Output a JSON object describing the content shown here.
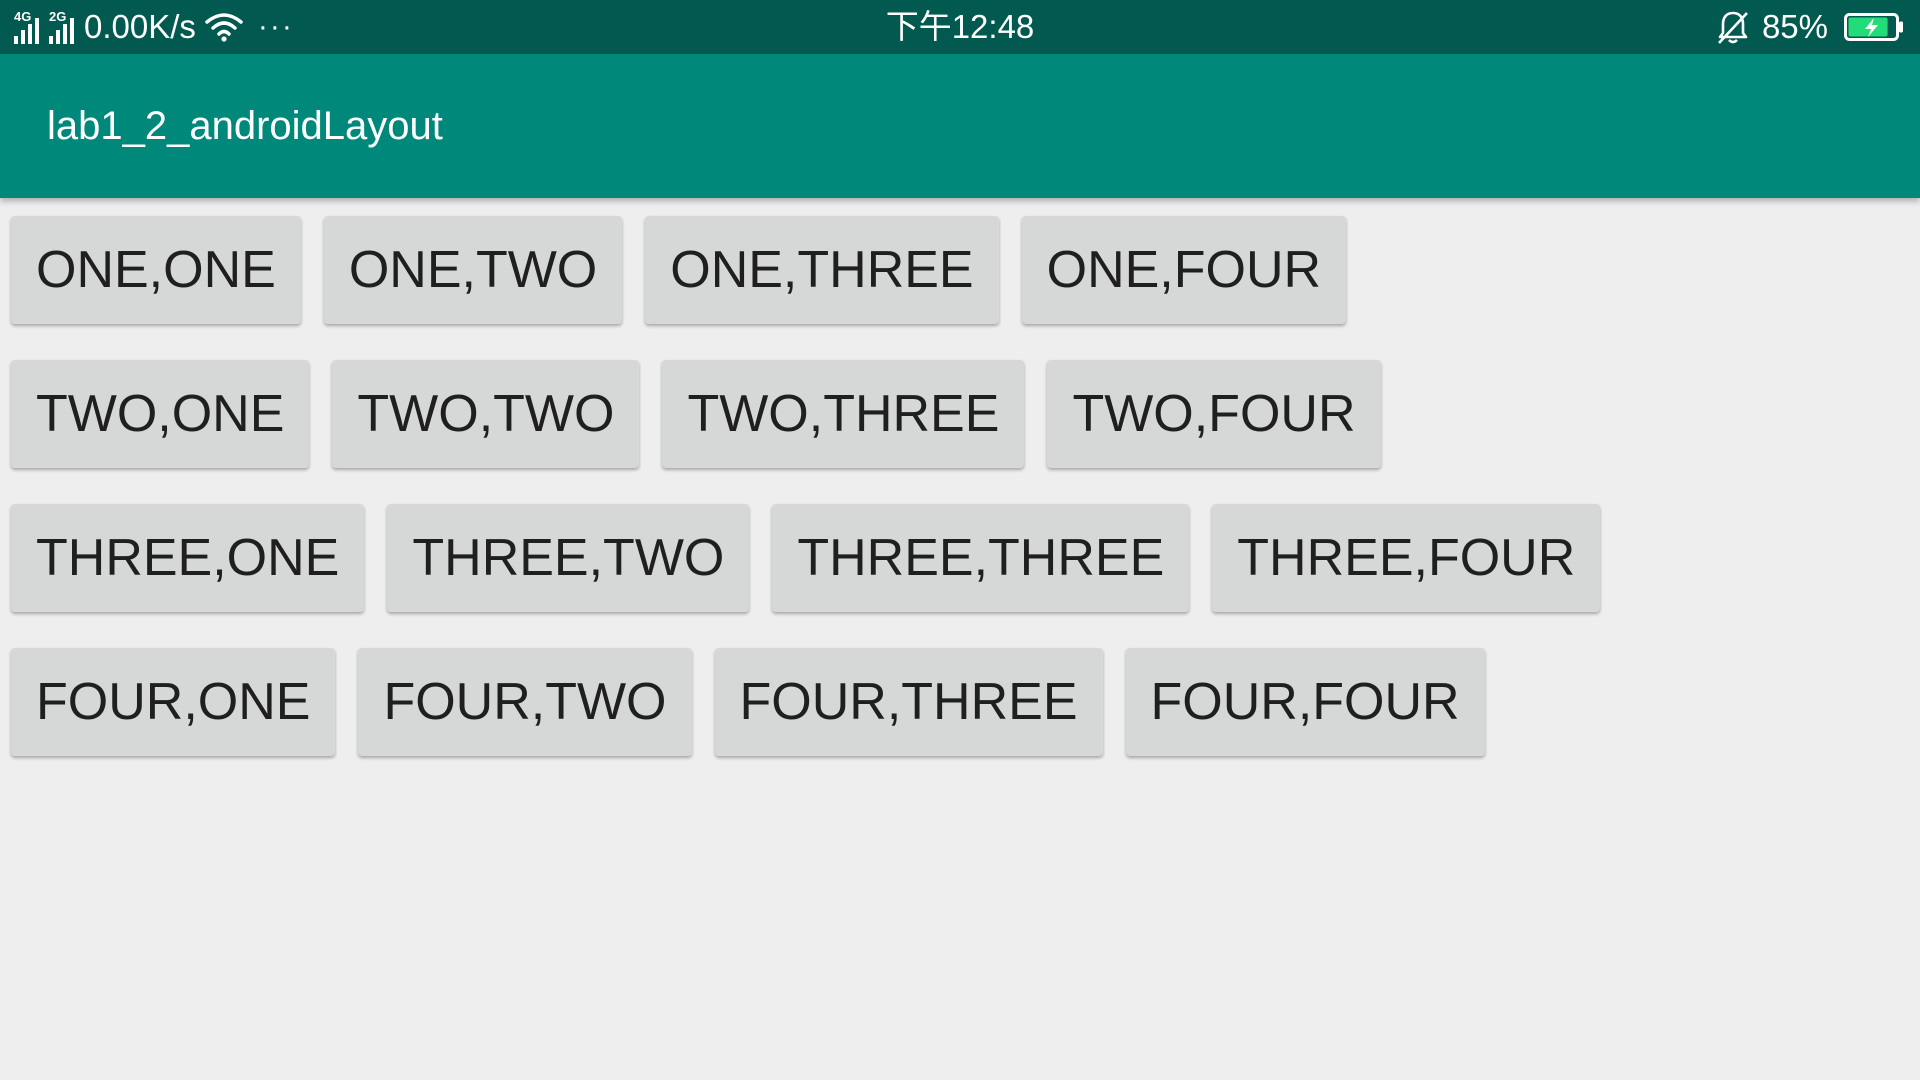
{
  "status_bar": {
    "signal1_gen": "4G",
    "signal2_gen": "2G",
    "net_speed": "0.00K/s",
    "more": "···",
    "time": "下午12:48",
    "battery_percent": "85%",
    "battery_level": 0.85,
    "icons": [
      "signal-4g-icon",
      "signal-2g-icon",
      "wifi-icon",
      "more-dots-icon",
      "bell-muted-icon",
      "battery-charging-icon"
    ],
    "battery_color": "#22dd77"
  },
  "app_bar": {
    "title": "lab1_2_androidLayout",
    "color": "#00897b"
  },
  "grid": {
    "rows": [
      [
        "ONE,ONE",
        "ONE,TWO",
        "ONE,THREE",
        "ONE,FOUR"
      ],
      [
        "TWO,ONE",
        "TWO,TWO",
        "TWO,THREE",
        "TWO,FOUR"
      ],
      [
        "THREE,ONE",
        "THREE,TWO",
        "THREE,THREE",
        "THREE,FOUR"
      ],
      [
        "FOUR,ONE",
        "FOUR,TWO",
        "FOUR,THREE",
        "FOUR,FOUR"
      ]
    ]
  }
}
